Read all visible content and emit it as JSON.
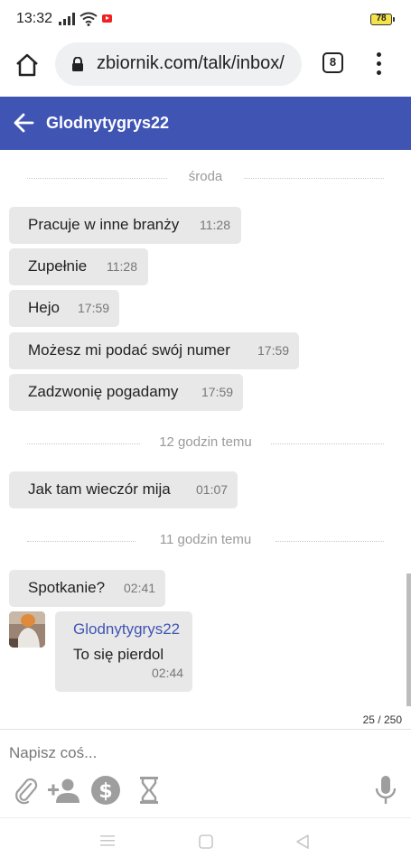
{
  "status_bar": {
    "time": "13:32",
    "battery": "78"
  },
  "browser": {
    "url": "zbiornik.com/talk/inbox/",
    "tab_count": "8"
  },
  "chat": {
    "title": "Glodnytygrys22",
    "dividers": [
      "środa",
      "12 godzin temu",
      "11 godzin temu"
    ],
    "messages": [
      {
        "text": "Pracuje w inne branży",
        "time": "11:28"
      },
      {
        "text": "Zupełnie",
        "time": "11:28"
      },
      {
        "text": "Hejo",
        "time": "17:59"
      },
      {
        "text": "Możesz mi podać swój numer",
        "time": "17:59"
      },
      {
        "text": "Zadzwonię pogadamy",
        "time": "17:59"
      },
      {
        "text": "Jak tam wieczór mija",
        "time": "01:07"
      },
      {
        "text": "Spotkanie?",
        "time": "02:41"
      }
    ],
    "reply": {
      "author": "Glodnytygrys22",
      "text": "To się pierdol",
      "time": "02:44"
    }
  },
  "composer": {
    "placeholder": "Napisz coś...",
    "counter": "25 / 250"
  },
  "icons": {
    "attach": "paperclip-icon",
    "add_user": "add-person-icon",
    "money": "dollar-icon",
    "timer": "hourglass-icon",
    "mic": "microphone-icon"
  },
  "colors": {
    "header": "#4054b4",
    "bubble": "#e8e8e8",
    "icon_gray": "#9e9e9e"
  }
}
